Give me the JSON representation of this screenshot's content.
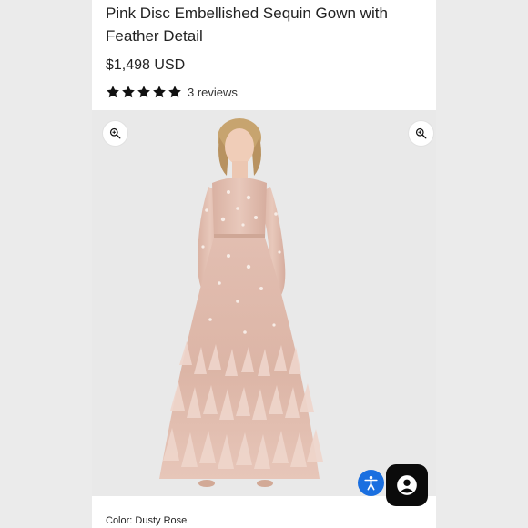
{
  "product": {
    "title": "Pink Disc Embellished Sequin Gown with Feather Detail",
    "price": "$1,498 USD",
    "rating": 5,
    "reviews": "3 reviews",
    "color_label": "Color: Dusty Rose"
  },
  "icons": {
    "zoom_left": "zoom-in-icon",
    "zoom_right": "zoom-in-icon",
    "accessibility": "accessibility-icon",
    "chat": "chat-account-icon",
    "star": "star-icon"
  },
  "colors": {
    "gown": "#e6c3b6",
    "accessibility_bg": "#1a6fe0",
    "chat_bg": "#0b0b0b",
    "background": "#ebebeb"
  }
}
